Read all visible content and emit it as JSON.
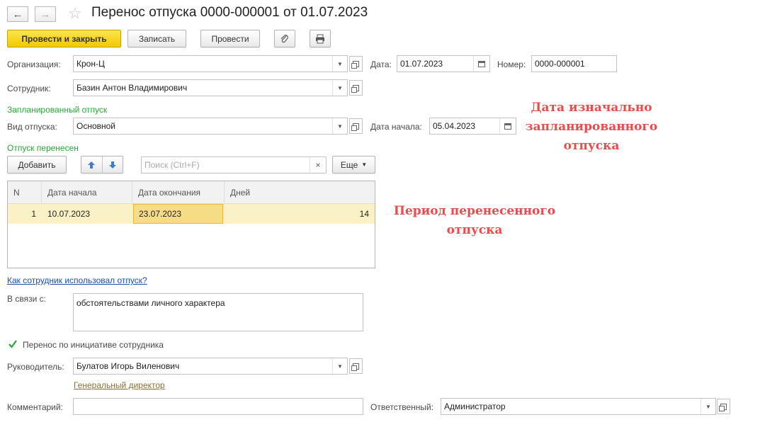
{
  "header": {
    "back_icon": "arrow-left-icon",
    "forward_icon": "arrow-right-icon",
    "star_icon": "star-icon",
    "title": "Перенос отпуска 0000-000001 от 01.07.2023"
  },
  "toolbar": {
    "post_close_label": "Провести и закрыть",
    "save_label": "Записать",
    "post_label": "Провести",
    "attach_icon": "paperclip-icon",
    "print_icon": "printer-icon"
  },
  "form": {
    "organization_label": "Организация:",
    "organization_value": "Крон-Ц",
    "date_label": "Дата:",
    "date_value": "01.07.2023",
    "number_label": "Номер:",
    "number_value": "0000-000001",
    "employee_label": "Сотрудник:",
    "employee_value": "Базин Антон Владимирович",
    "planned_section": "Запланированный отпуск",
    "vacation_type_label": "Вид отпуска:",
    "vacation_type_value": "Основной",
    "start_date_label": "Дата начала:",
    "start_date_value": "05.04.2023",
    "moved_section": "Отпуск перенесен"
  },
  "table_toolbar": {
    "add_label": "Добавить",
    "search_placeholder": "Поиск (Ctrl+F)",
    "clear_symbol": "×",
    "more_label": "Еще"
  },
  "table": {
    "columns": [
      "N",
      "Дата начала",
      "Дата окончания",
      "Дней"
    ],
    "rows": [
      {
        "n": "1",
        "start": "10.07.2023",
        "end": "23.07.2023",
        "days": "14"
      }
    ]
  },
  "annotations": {
    "planned_note_line1": "Дата изначально",
    "planned_note_line2": "запланированного",
    "planned_note_line3": "отпуска",
    "moved_note_line1": "Период перенесенного",
    "moved_note_line2": "отпуска"
  },
  "lower": {
    "usage_link": "Как сотрудник использовал отпуск?",
    "reason_label": "В связи с:",
    "reason_value": "обстоятельствами личного характера",
    "initiative_label": "Перенос по инициативе сотрудника",
    "initiative_checked": true,
    "manager_label": "Руководитель:",
    "manager_value": "Булатов Игорь Виленович",
    "manager_position": "Генеральный директор",
    "comment_label": "Комментарий:",
    "comment_value": "",
    "responsible_label": "Ответственный:",
    "responsible_value": "Администратор"
  },
  "colors": {
    "primary_button": "#f5cf00",
    "section_green": "#2aa53a",
    "annotation_red": "#ec4b4b",
    "selected_row": "#fbf1c6",
    "selected_cell": "#f7dc86"
  }
}
